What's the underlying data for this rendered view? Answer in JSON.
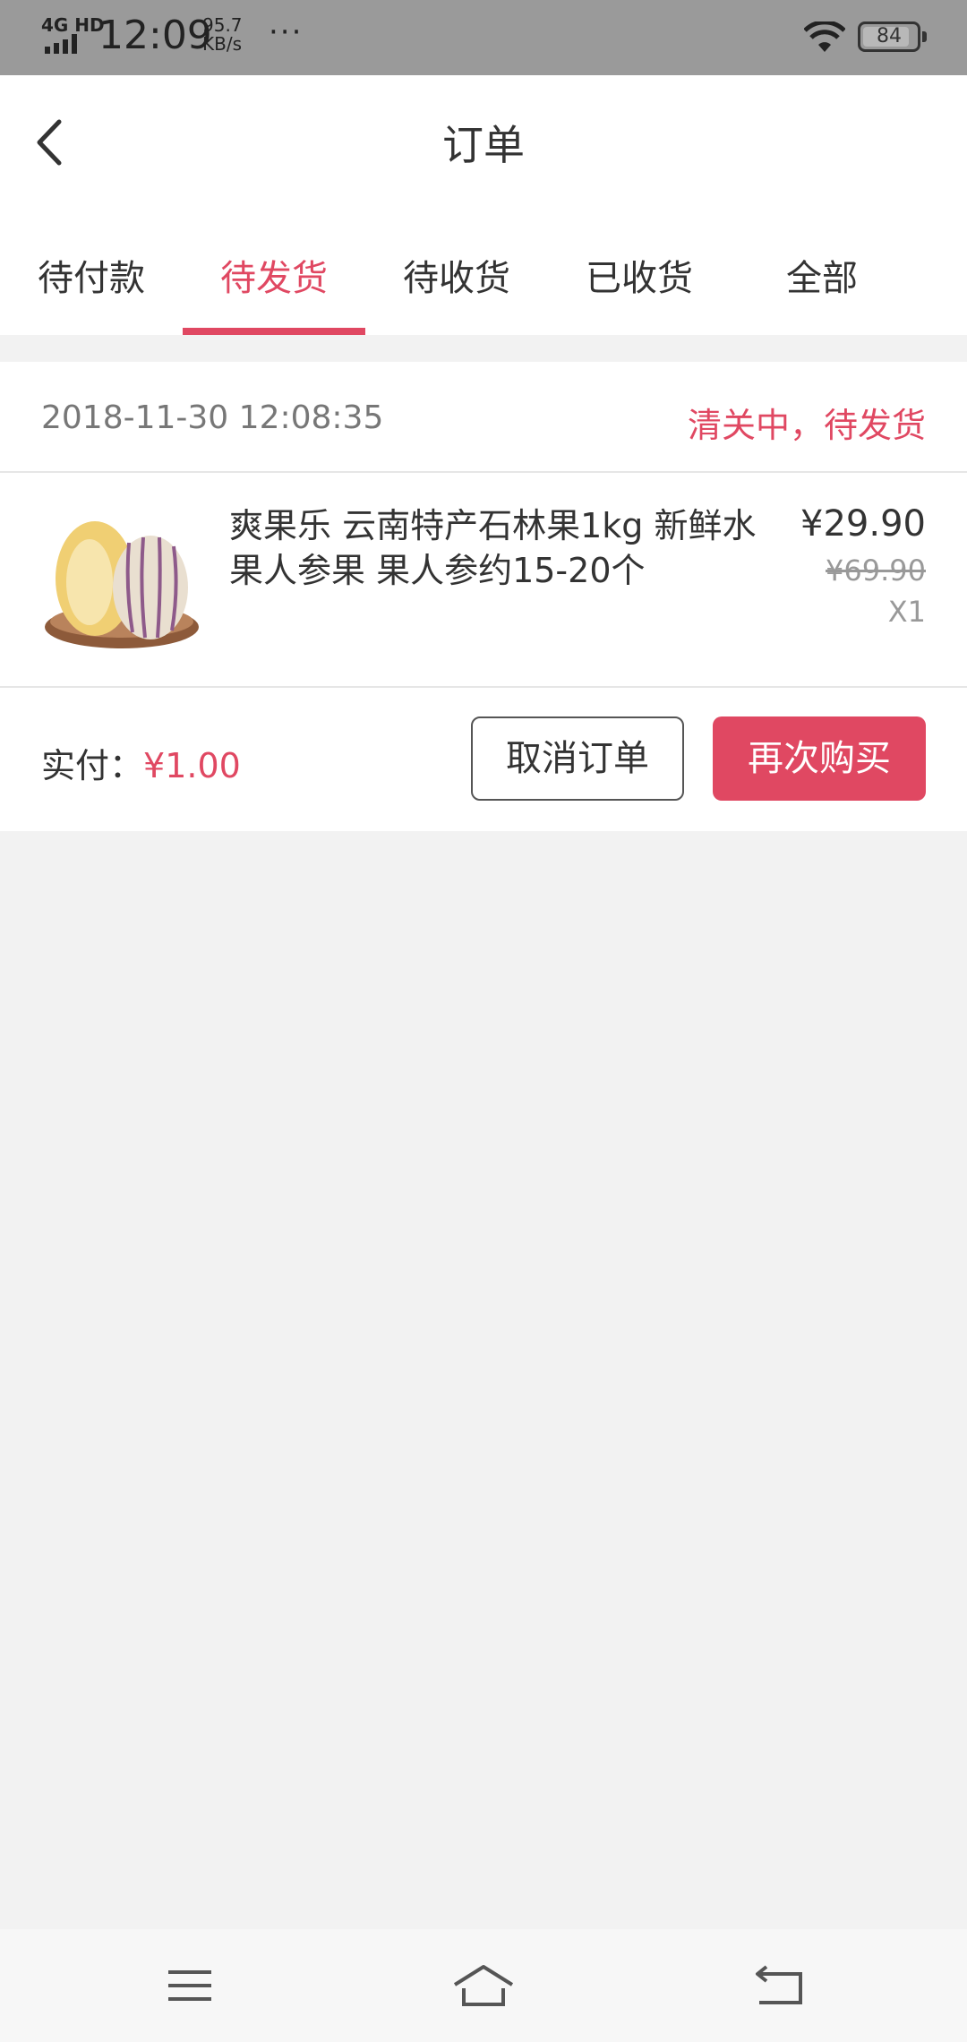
{
  "status_bar": {
    "network": "4G HD",
    "time": "12:09",
    "speed_value": "95.7",
    "speed_unit": "KB/s",
    "more": "···",
    "battery": "84"
  },
  "header": {
    "title": "订单",
    "back_icon": "chevron-left-icon"
  },
  "tabs": [
    {
      "label": "待付款",
      "active": false
    },
    {
      "label": "待发货",
      "active": true
    },
    {
      "label": "待收货",
      "active": false
    },
    {
      "label": "已收货",
      "active": false
    },
    {
      "label": "全部",
      "active": false
    }
  ],
  "order": {
    "time": "2018-11-30 12:08:35",
    "status": "清关中，待发货",
    "item": {
      "title": "爽果乐 云南特产石林果1kg 新鲜水果人参果 果人参约15-20个",
      "price": "¥29.90",
      "original_price": "¥69.90",
      "quantity": "X1"
    },
    "paid_label": "实付：",
    "paid_amount": "¥1.00",
    "cancel_label": "取消订单",
    "rebuy_label": "再次购买"
  },
  "nav_bar": {
    "menu_icon": "menu-icon",
    "home_icon": "home-icon",
    "back_icon": "back-icon"
  },
  "colors": {
    "accent": "#e04862",
    "status_bar": "#9a9a9a",
    "background": "#f2f2f2"
  }
}
